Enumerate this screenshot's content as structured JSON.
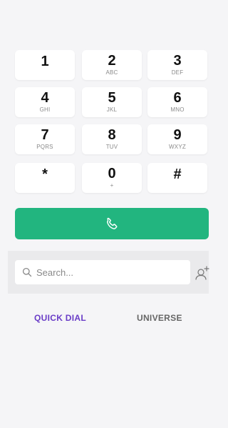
{
  "keypad": {
    "keys": [
      {
        "digit": "1",
        "letters": ""
      },
      {
        "digit": "2",
        "letters": "ABC"
      },
      {
        "digit": "3",
        "letters": "DEF"
      },
      {
        "digit": "4",
        "letters": "GHI"
      },
      {
        "digit": "5",
        "letters": "JKL"
      },
      {
        "digit": "6",
        "letters": "MNO"
      },
      {
        "digit": "7",
        "letters": "PQRS"
      },
      {
        "digit": "8",
        "letters": "TUV"
      },
      {
        "digit": "9",
        "letters": "WXYZ"
      },
      {
        "digit": "*",
        "letters": ""
      },
      {
        "digit": "0",
        "letters": "+"
      },
      {
        "digit": "#",
        "letters": ""
      }
    ]
  },
  "call": {
    "icon": "phone-icon",
    "color": "#22b57f"
  },
  "search": {
    "placeholder": "Search...",
    "value": ""
  },
  "tabs": [
    {
      "label": "QUICK DIAL",
      "active": true
    },
    {
      "label": "UNIVERSE",
      "active": false
    }
  ],
  "colors": {
    "accent": "#6a3dc7",
    "call_green": "#22b57f"
  }
}
